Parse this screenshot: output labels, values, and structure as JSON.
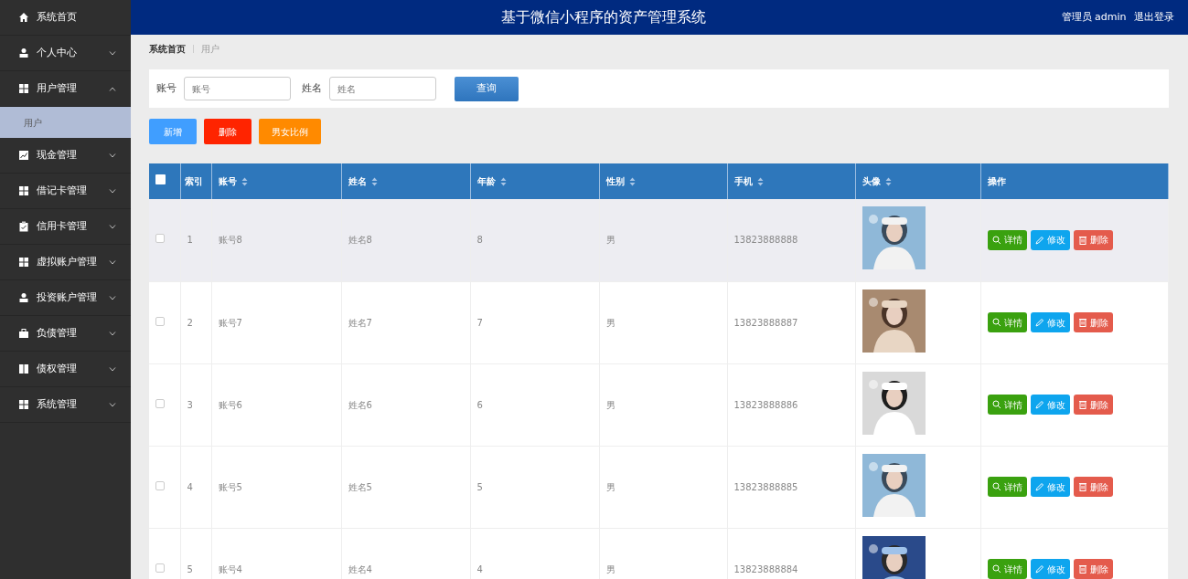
{
  "header": {
    "title": "基于微信小程序的资产管理系统",
    "user": "管理员 admin",
    "logout": "退出登录"
  },
  "sidebar": {
    "items": [
      {
        "label": "系统首页",
        "kind": "home"
      },
      {
        "label": "个人中心",
        "kind": "user",
        "expanded": false
      },
      {
        "label": "用户管理",
        "kind": "grid",
        "expanded": true,
        "children": [
          {
            "label": "用户",
            "selected": true
          }
        ]
      },
      {
        "label": "现金管理",
        "kind": "chart",
        "expanded": false
      },
      {
        "label": "借记卡管理",
        "kind": "grid",
        "expanded": false
      },
      {
        "label": "信用卡管理",
        "kind": "clipboard",
        "expanded": false
      },
      {
        "label": "虚拟账户管理",
        "kind": "grid",
        "expanded": false
      },
      {
        "label": "投资账户管理",
        "kind": "user",
        "expanded": false
      },
      {
        "label": "负债管理",
        "kind": "briefcase",
        "expanded": false
      },
      {
        "label": "债权管理",
        "kind": "book",
        "expanded": false
      },
      {
        "label": "系统管理",
        "kind": "grid",
        "expanded": false
      }
    ]
  },
  "breadcrumb": [
    "系统首页",
    "用户"
  ],
  "search": {
    "fields": [
      {
        "label": "账号",
        "placeholder": "账号"
      },
      {
        "label": "姓名",
        "placeholder": "姓名"
      }
    ],
    "button": "查询"
  },
  "actions": [
    {
      "label": "新增",
      "kind": "add"
    },
    {
      "label": "删除",
      "kind": "delete"
    },
    {
      "label": "男女比例",
      "kind": "chart"
    }
  ],
  "table": {
    "all_checked": false,
    "columns": [
      {
        "label": "索引",
        "sortable": false
      },
      {
        "label": "账号",
        "sortable": true
      },
      {
        "label": "姓名",
        "sortable": true
      },
      {
        "label": "年龄",
        "sortable": true
      },
      {
        "label": "性别",
        "sortable": true
      },
      {
        "label": "手机",
        "sortable": true
      },
      {
        "label": "头像",
        "sortable": true
      },
      {
        "label": "操作",
        "sortable": false
      }
    ],
    "rows": [
      {
        "checked": false,
        "hovered": true,
        "cells": [
          "1",
          "账号8",
          "姓名8",
          "8",
          "男",
          "13823888888"
        ],
        "actions": [
          {
            "label": "详情",
            "kind": "view"
          },
          {
            "label": "修改",
            "kind": "edit"
          },
          {
            "label": "删除",
            "kind": "delete"
          }
        ]
      },
      {
        "checked": false,
        "hovered": false,
        "cells": [
          "2",
          "账号7",
          "姓名7",
          "7",
          "男",
          "13823888887"
        ],
        "actions": [
          {
            "label": "详情",
            "kind": "view"
          },
          {
            "label": "修改",
            "kind": "edit"
          },
          {
            "label": "删除",
            "kind": "delete"
          }
        ]
      },
      {
        "checked": false,
        "hovered": false,
        "cells": [
          "3",
          "账号6",
          "姓名6",
          "6",
          "男",
          "13823888886"
        ],
        "actions": [
          {
            "label": "详情",
            "kind": "view"
          },
          {
            "label": "修改",
            "kind": "edit"
          },
          {
            "label": "删除",
            "kind": "delete"
          }
        ]
      },
      {
        "checked": false,
        "hovered": false,
        "cells": [
          "4",
          "账号5",
          "姓名5",
          "5",
          "男",
          "13823888885"
        ],
        "actions": [
          {
            "label": "详情",
            "kind": "view"
          },
          {
            "label": "修改",
            "kind": "edit"
          },
          {
            "label": "删除",
            "kind": "delete"
          }
        ]
      },
      {
        "checked": false,
        "hovered": false,
        "cells": [
          "5",
          "账号4",
          "姓名4",
          "4",
          "男",
          "13823888884"
        ],
        "actions": [
          {
            "label": "详情",
            "kind": "view"
          },
          {
            "label": "修改",
            "kind": "edit"
          },
          {
            "label": "删除",
            "kind": "delete"
          }
        ]
      }
    ]
  }
}
